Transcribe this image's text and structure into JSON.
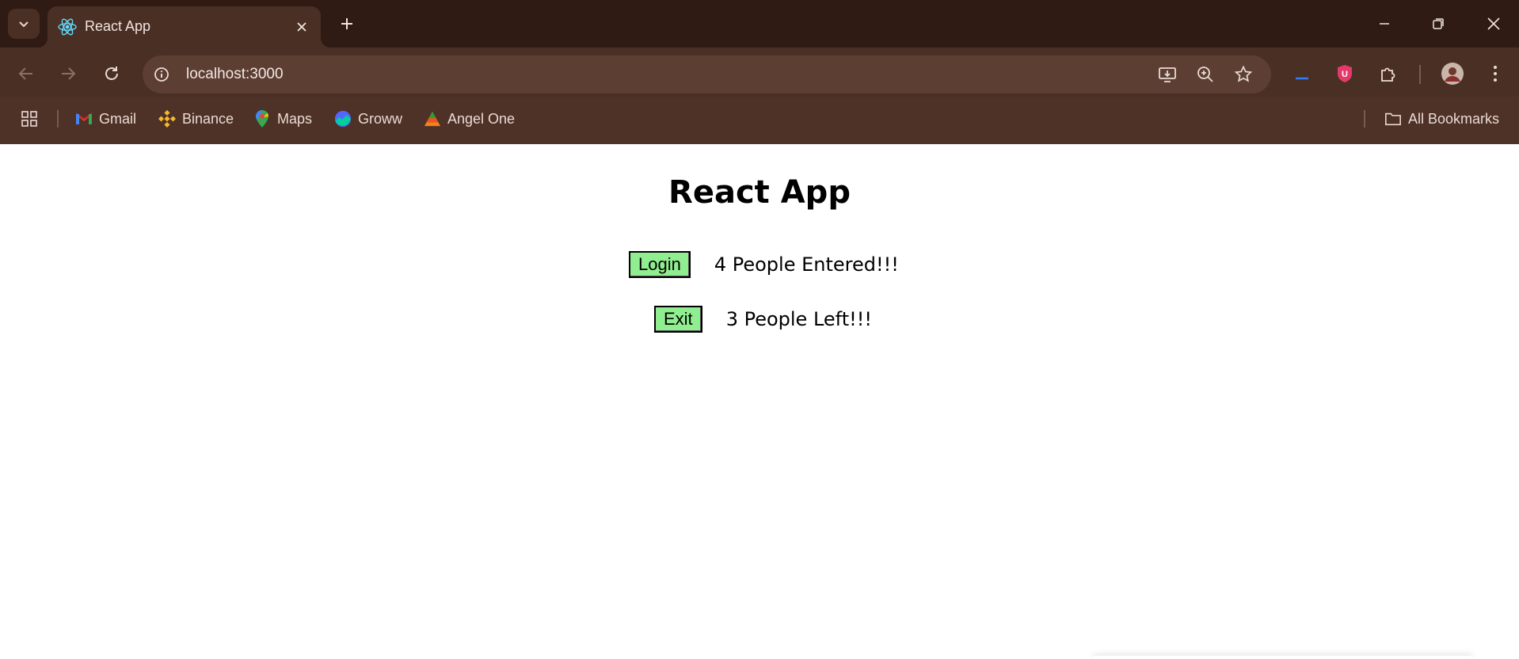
{
  "browser": {
    "tab": {
      "title": "React App"
    },
    "address": {
      "url": "localhost:3000"
    },
    "bookmarks": [
      {
        "label": "Gmail",
        "icon": "gmail-icon"
      },
      {
        "label": "Binance",
        "icon": "binance-icon"
      },
      {
        "label": "Maps",
        "icon": "maps-icon"
      },
      {
        "label": "Groww",
        "icon": "groww-icon"
      },
      {
        "label": "Angel One",
        "icon": "angel-one-icon"
      }
    ],
    "all_bookmarks_label": "All Bookmarks",
    "colors": {
      "tabstrip": "#2f1b13",
      "toolbar": "#4a2f25",
      "omnibox": "#5c3e33"
    }
  },
  "app": {
    "title": "React App",
    "login_button": "Login",
    "entered_text": "4 People Entered!!!",
    "exit_button": "Exit",
    "left_text": "3 People Left!!!",
    "button_color": "#90ee90"
  }
}
